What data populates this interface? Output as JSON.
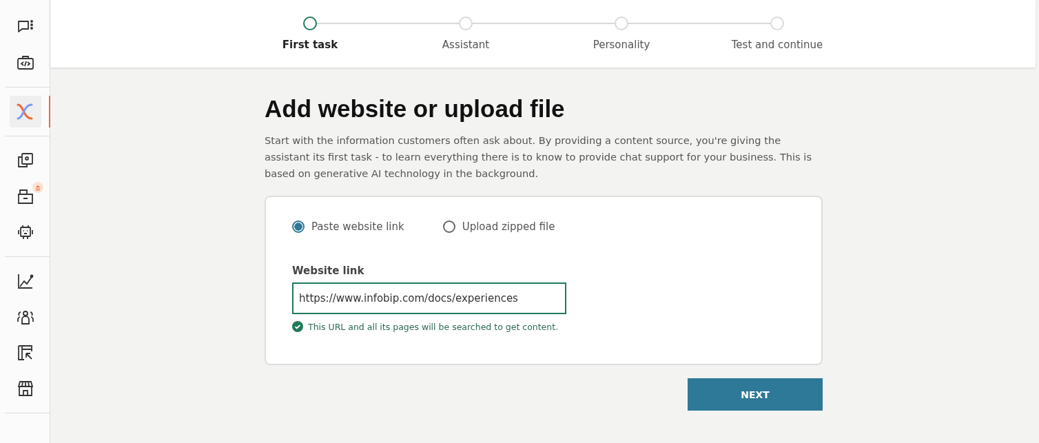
{
  "sidebar": {
    "groups": [
      {
        "items": [
          {
            "kind": "chat",
            "selected": false,
            "badge": false
          },
          {
            "kind": "code",
            "selected": false,
            "badge": false
          }
        ]
      },
      {
        "items": [
          {
            "kind": "logo",
            "selected": true,
            "badge": false
          }
        ]
      },
      {
        "items": [
          {
            "kind": "copy",
            "selected": false,
            "badge": false
          },
          {
            "kind": "inbox",
            "selected": false,
            "badge": true
          },
          {
            "kind": "robot",
            "selected": false,
            "badge": false
          }
        ]
      },
      {
        "items": [
          {
            "kind": "chart",
            "selected": false,
            "badge": false
          },
          {
            "kind": "people",
            "selected": false,
            "badge": false
          },
          {
            "kind": "layout",
            "selected": false,
            "badge": false
          },
          {
            "kind": "store",
            "selected": false,
            "badge": false
          }
        ]
      }
    ]
  },
  "steps": [
    {
      "label": "First task",
      "selected": true
    },
    {
      "label": "Assistant",
      "selected": false
    },
    {
      "label": "Personality",
      "selected": false
    },
    {
      "label": "Test and continue",
      "selected": false
    }
  ],
  "heading": "Add website or upload file",
  "description": "Start with the information customers often ask about. By providing a content source, you're giving the assistant its first task - to learn everything there is to know to provide chat support for your business. This is based on generative AI technology in the background.",
  "source_options": [
    {
      "label": "Paste website link",
      "selected": true
    },
    {
      "label": "Upload zipped file",
      "selected": false
    }
  ],
  "website_field": {
    "label": "Website link",
    "value": "https://www.infobip.com/docs/experiences",
    "hint": "This URL and all its pages will be searched to get content."
  },
  "next_button": "NEXT"
}
